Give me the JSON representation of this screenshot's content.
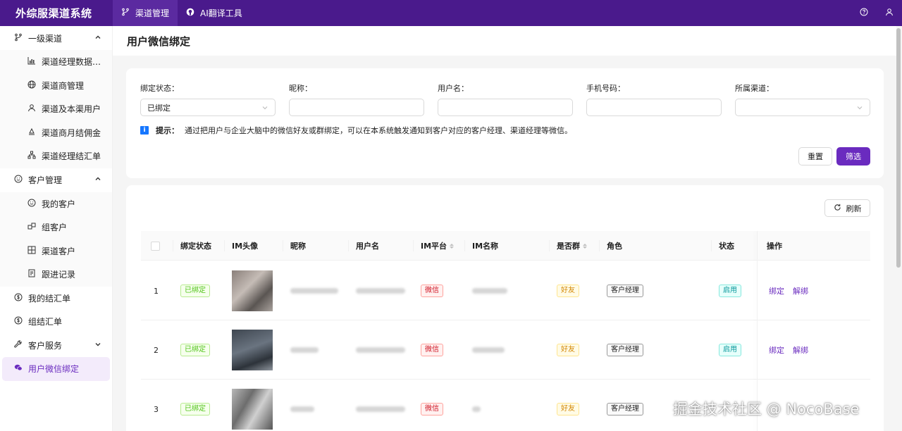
{
  "app": {
    "title": "外综服渠道系统"
  },
  "topnav": [
    {
      "label": "渠道管理",
      "icon": "branch-icon",
      "active": true
    },
    {
      "label": "AI翻译工具",
      "icon": "github-icon",
      "active": false
    }
  ],
  "sidebar": {
    "group1": {
      "label": "一级渠道",
      "icon": "branch-icon"
    },
    "group1_items": [
      {
        "label": "渠道经理数据统计",
        "icon": "chart-icon"
      },
      {
        "label": "渠道商管理",
        "icon": "globe-icon"
      },
      {
        "label": "渠道及本渠用户",
        "icon": "user-icon"
      },
      {
        "label": "渠道商月结佣金",
        "icon": "commission-icon"
      },
      {
        "label": "渠道经理结汇单",
        "icon": "org-icon"
      }
    ],
    "group2": {
      "label": "客户管理",
      "icon": "smile-icon"
    },
    "group2_items": [
      {
        "label": "我的客户",
        "icon": "smile-icon"
      },
      {
        "label": "组客户",
        "icon": "group-icon"
      },
      {
        "label": "渠道客户",
        "icon": "grid-icon"
      },
      {
        "label": "跟进记录",
        "icon": "record-icon"
      }
    ],
    "bottom_items": [
      {
        "label": "我的结汇单",
        "icon": "dollar-icon"
      },
      {
        "label": "组结汇单",
        "icon": "dollar-icon"
      },
      {
        "label": "客户服务",
        "icon": "wrench-icon"
      },
      {
        "label": "用户微信绑定",
        "icon": "wechat-icon",
        "selected": true
      }
    ]
  },
  "page": {
    "title": "用户微信绑定"
  },
  "filters": {
    "bind_status": {
      "label": "绑定状态：",
      "value": "已绑定"
    },
    "nickname": {
      "label": "昵称：",
      "value": ""
    },
    "username": {
      "label": "用户名：",
      "value": ""
    },
    "phone": {
      "label": "手机号码：",
      "value": ""
    },
    "channel": {
      "label": "所属渠道：",
      "value": ""
    },
    "tip_head": "提示：",
    "tip_text": "通过把用户与企业大脑中的微信好友或群绑定，可以在本系统触发通知到客户对应的客户经理、渠道经理等微信。",
    "reset_label": "重置",
    "filter_label": "筛选"
  },
  "table": {
    "refresh_label": "刷新",
    "columns": [
      "绑定状态",
      "IM头像",
      "昵称",
      "用户名",
      "IM平台",
      "IM名称",
      "是否群",
      "角色",
      "状态",
      "操作"
    ],
    "rows": [
      {
        "index": "1",
        "bind_status": "已绑定",
        "platform": "微信",
        "is_group": "好友",
        "role": "客户经理",
        "status": "启用",
        "action_bind": "绑定",
        "action_unbind": "解绑"
      },
      {
        "index": "2",
        "bind_status": "已绑定",
        "platform": "微信",
        "is_group": "好友",
        "role": "客户经理",
        "status": "启用",
        "action_bind": "绑定",
        "action_unbind": "解绑"
      },
      {
        "index": "3",
        "bind_status": "已绑定",
        "platform": "微信",
        "is_group": "好友",
        "role": "客户经理",
        "status": "",
        "action_bind": "",
        "action_unbind": ""
      }
    ]
  },
  "watermark": "掘金技术社区 @ NocoBase",
  "colors": {
    "header": "#4a1a8c",
    "accent": "#6a2bbf"
  }
}
